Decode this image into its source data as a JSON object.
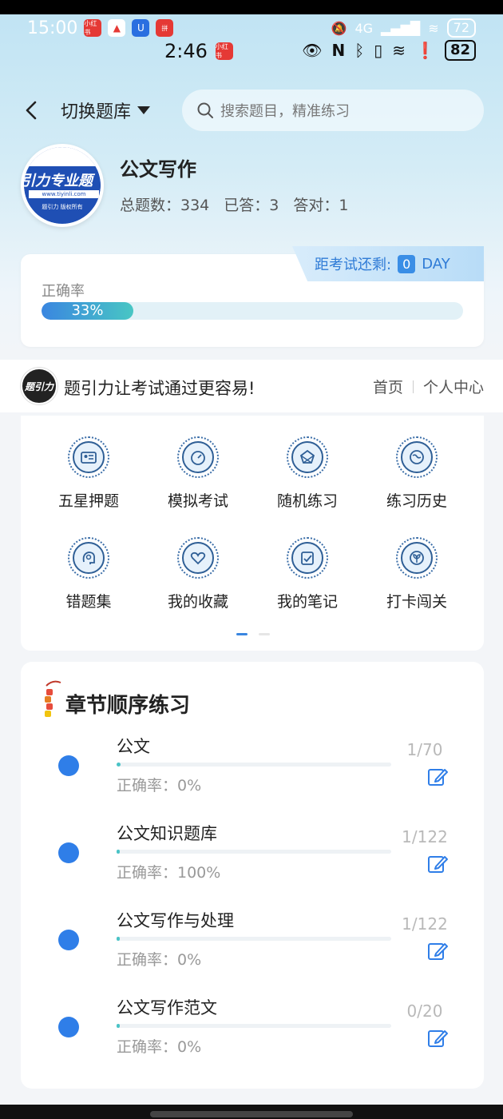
{
  "status_top": {
    "time": "15:00",
    "battery": "72",
    "network": "4G"
  },
  "status_second": {
    "time": "2:46",
    "battery": "82"
  },
  "nav": {
    "switch_label": "切换题库",
    "search_placeholder": "搜索题目，精准练习"
  },
  "course": {
    "title": "公文写作",
    "total_label": "总题数：334",
    "answered_label": "已答：3",
    "correct_label": "答对：1",
    "logo_band": "引力专业题",
    "logo_url": "www.tiyinli.com",
    "logo_foot": "题引力 版权所有"
  },
  "progress": {
    "countdown_label": "距考试还剩:",
    "countdown_days": "0",
    "countdown_unit": "DAY",
    "rate_label": "正确率",
    "rate_text": "33%",
    "rate_value": 0.33
  },
  "brand": {
    "slogan": "题引力让考试通过更容易!",
    "link_home": "首页",
    "link_profile": "个人中心",
    "logo_text": "题引力"
  },
  "features": [
    {
      "label": "五星押题",
      "icon": "id-card-icon"
    },
    {
      "label": "模拟考试",
      "icon": "gauge-icon"
    },
    {
      "label": "随机练习",
      "icon": "shuffle-icon"
    },
    {
      "label": "练习历史",
      "icon": "globe-icon"
    },
    {
      "label": "错题集",
      "icon": "head-icon"
    },
    {
      "label": "我的收藏",
      "icon": "heart-icon"
    },
    {
      "label": "我的笔记",
      "icon": "note-check-icon"
    },
    {
      "label": "打卡闯关",
      "icon": "leaf-icon"
    }
  ],
  "chapters": {
    "title": "章节顺序练习",
    "items": [
      {
        "name": "公文",
        "rate": "正确率：0%",
        "count": "1/70",
        "progress": 0.014
      },
      {
        "name": "公文知识题库",
        "rate": "正确率：100%",
        "count": "1/122",
        "progress": 0.008
      },
      {
        "name": "公文写作与处理",
        "rate": "正确率：0%",
        "count": "1/122",
        "progress": 0.008
      },
      {
        "name": "公文写作范文",
        "rate": "正确率：0%",
        "count": "0/20",
        "progress": 0
      }
    ]
  },
  "colors": {
    "accent": "#2f7ee8",
    "bar_end": "#48c6c4"
  }
}
